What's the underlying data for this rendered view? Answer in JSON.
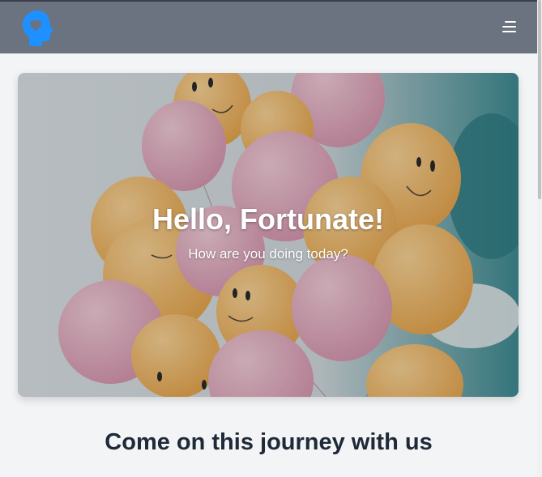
{
  "navbar": {
    "logo_icon": "head-heart-icon",
    "menu_icon": "hamburger-menu-icon",
    "background": "#6b7280",
    "logo_color": "#1e90ff"
  },
  "hero": {
    "title": "Hello, Fortunate!",
    "subtitle": "How are you doing today?",
    "image": "smiley-balloons-photo"
  },
  "section": {
    "title": "Come on this journey with us"
  }
}
